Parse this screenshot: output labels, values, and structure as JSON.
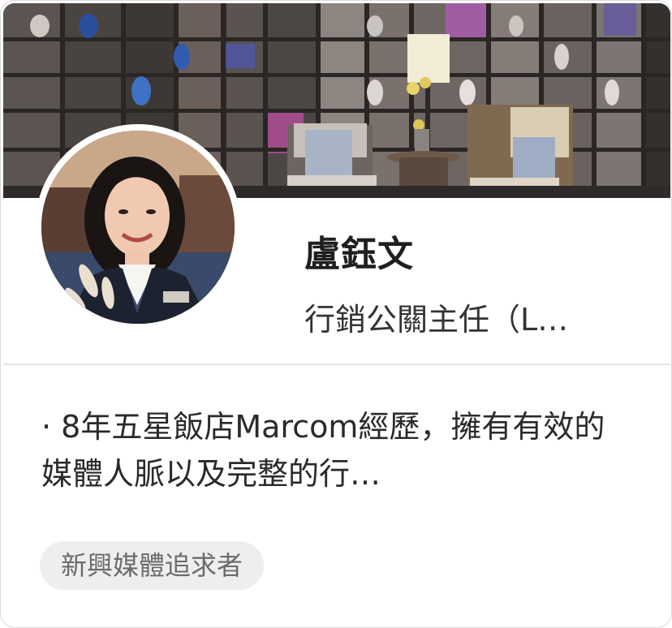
{
  "profile": {
    "name": "盧鈺文",
    "title": "行銷公關主任（L…",
    "bio": "· 8年五星飯店Marcom經歷，擁有有效的媒體人脈以及完整的行…",
    "tag": "新興媒體追求者"
  },
  "images": {
    "cover": "cover-photo",
    "avatar": "profile-photo"
  }
}
